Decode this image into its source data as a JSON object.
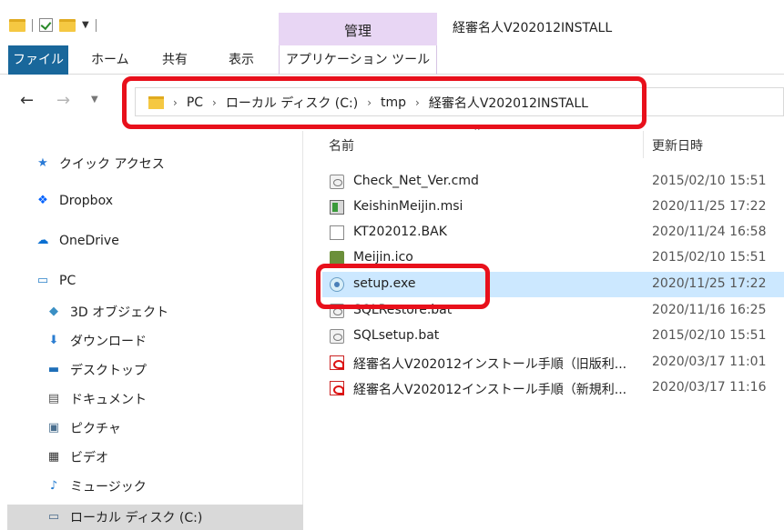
{
  "titlebar": {
    "context_tab_header": "管理",
    "window_title": "経審名人V202012INSTALL"
  },
  "ribbon": {
    "tabs": [
      "ファイル",
      "ホーム",
      "共有",
      "表示",
      "アプリケーション ツール"
    ]
  },
  "address": {
    "segments": [
      "PC",
      "ローカル ディスク (C:)",
      "tmp",
      "経審名人V202012INSTALL"
    ]
  },
  "sidebar": {
    "items": [
      {
        "label": "クイック アクセス",
        "icon": "star-icon"
      },
      {
        "label": "Dropbox",
        "icon": "dropbox-icon"
      },
      {
        "label": "OneDrive",
        "icon": "cloud-icon"
      },
      {
        "label": "PC",
        "icon": "monitor-icon"
      },
      {
        "label": "3D オブジェクト",
        "icon": "cube-icon"
      },
      {
        "label": "ダウンロード",
        "icon": "download-icon"
      },
      {
        "label": "デスクトップ",
        "icon": "desktop-icon"
      },
      {
        "label": "ドキュメント",
        "icon": "document-icon"
      },
      {
        "label": "ピクチャ",
        "icon": "picture-icon"
      },
      {
        "label": "ビデオ",
        "icon": "video-icon"
      },
      {
        "label": "ミュージック",
        "icon": "music-icon"
      },
      {
        "label": "ローカル ディスク (C:)",
        "icon": "disk-icon"
      }
    ]
  },
  "list": {
    "columns": {
      "name": "名前",
      "date": "更新日時"
    },
    "files": [
      {
        "name": "Check_Net_Ver.cmd",
        "date": "2015/02/10 15:51",
        "icon": "cmd-file-icon"
      },
      {
        "name": "KeishinMeijin.msi",
        "date": "2020/11/25 17:22",
        "icon": "msi-file-icon"
      },
      {
        "name": "KT202012.BAK",
        "date": "2020/11/24 16:58",
        "icon": "blank-file-icon"
      },
      {
        "name": "Meijin.ico",
        "date": "2015/02/10 15:51",
        "icon": "ico-file-icon"
      },
      {
        "name": "setup.exe",
        "date": "2020/11/25 17:22",
        "icon": "exe-file-icon",
        "selected": true
      },
      {
        "name": "SQLRestore.bat",
        "date": "2020/11/16 16:25",
        "icon": "bat-file-icon"
      },
      {
        "name": "SQLsetup.bat",
        "date": "2015/02/10 15:51",
        "icon": "bat-file-icon"
      },
      {
        "name": "経審名人V202012インストール手順（旧版利...",
        "date": "2020/03/17 11:01",
        "icon": "pdf-file-icon"
      },
      {
        "name": "経審名人V202012インストール手順（新規利...",
        "date": "2020/03/17 11:16",
        "icon": "pdf-file-icon"
      }
    ]
  },
  "colors": {
    "file_tab": "#19679b",
    "context_tab": "#e8d6f4",
    "selection": "#cce8ff",
    "highlight_outline": "#e8101b"
  }
}
